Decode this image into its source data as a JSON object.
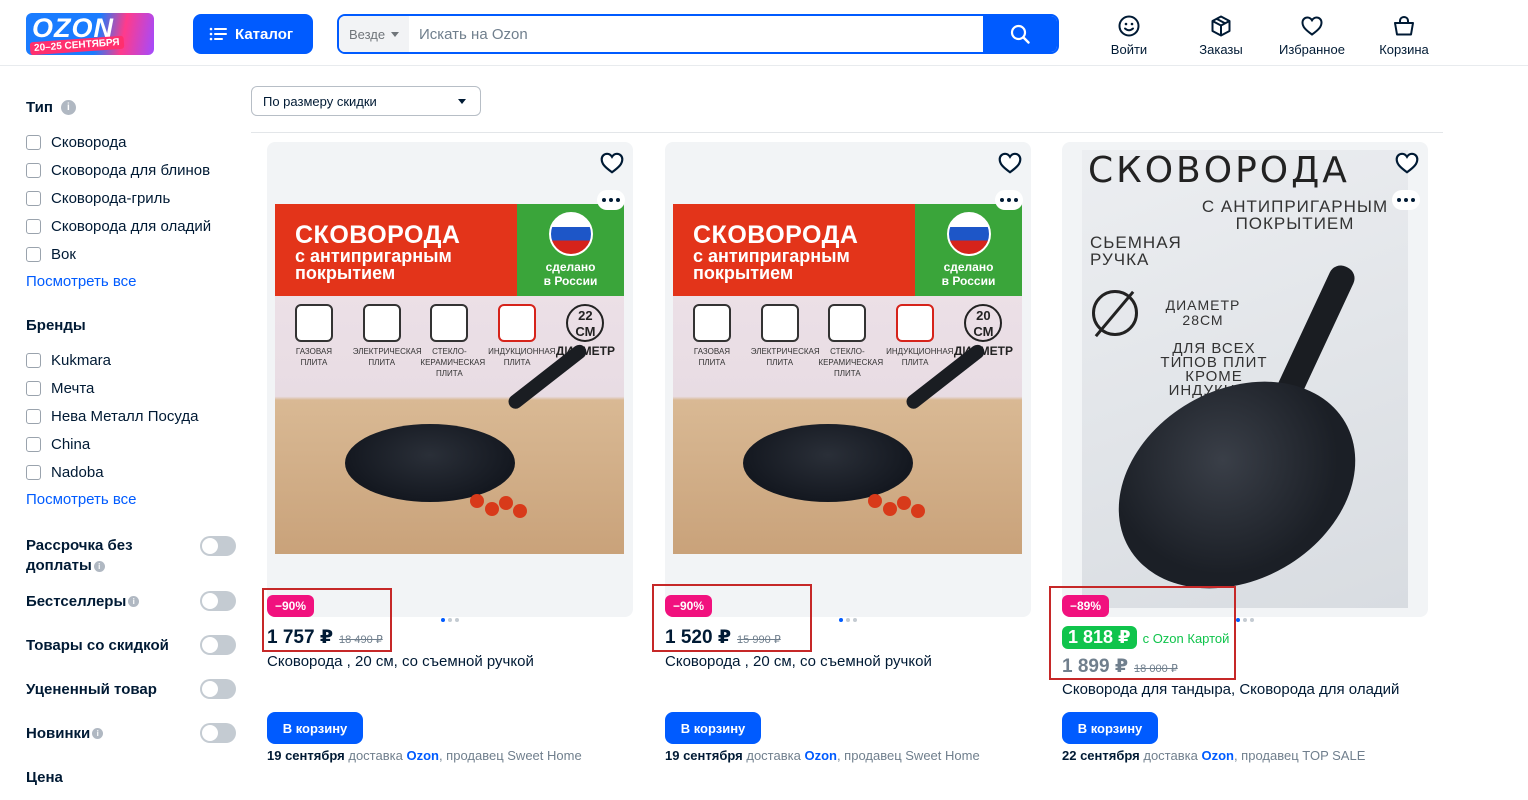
{
  "header": {
    "logo_text": "OZON",
    "logo_dates": "20–25 СЕНТЯБРЯ",
    "catalog_label": "Каталог",
    "search_scope": "Везде",
    "search_placeholder": "Искать на Ozon",
    "icons": [
      {
        "name": "user-smile-icon",
        "label": "Войти"
      },
      {
        "name": "box-icon",
        "label": "Заказы"
      },
      {
        "name": "heart-icon",
        "label": "Избранное"
      },
      {
        "name": "bag-icon",
        "label": "Корзина"
      }
    ]
  },
  "sidebar": {
    "type_title": "Тип",
    "type_items": [
      "Сковорода",
      "Сковорода для блинов",
      "Сковорода-гриль",
      "Сковорода для оладий",
      "Вок"
    ],
    "see_all": "Посмотреть все",
    "brands_title": "Бренды",
    "brand_items": [
      "Kukmara",
      "Мечта",
      "Нева Металл Посуда",
      "China",
      "Nadoba"
    ],
    "toggles": [
      {
        "label": "Рассрочка без доплаты",
        "info": true,
        "on": false
      },
      {
        "label": "Бестселлеры",
        "info": true,
        "on": false
      },
      {
        "label": "Товары со скидкой",
        "info": false,
        "on": false
      },
      {
        "label": "Уцененный товар",
        "info": false,
        "on": false
      },
      {
        "label": "Новинки",
        "info": true,
        "on": false
      }
    ],
    "price_title": "Цена"
  },
  "sort": {
    "selected": "По размеру скидки"
  },
  "products": [
    {
      "discount": "−90%",
      "price": "1 757 ₽",
      "old_price": "18 490 ₽",
      "name": "Сковорода , 20 см, со съемной ручкой",
      "buy_label": "В корзину",
      "delivery_date": "19 сентября",
      "delivery_text": "доставка",
      "delivery_service": "Ozon",
      "seller": ", продавец Sweet Home",
      "image": {
        "title": "СКОВОРОДА",
        "sub1": "с антипригарным",
        "sub2": "покрытием",
        "made": "сделано",
        "made2": "в России",
        "stoves": [
          "ГАЗОВАЯ ПЛИТА",
          "ЭЛЕКТРИЧЕСКАЯ ПЛИТА",
          "СТЕКЛО-КЕРАМИЧЕСКАЯ ПЛИТА",
          "ИНДУКЦИОННАЯ ПЛИТА"
        ],
        "diam_num": "22",
        "diam_unit": "СМ",
        "diam_label": "ДИАМЕТР"
      }
    },
    {
      "discount": "−90%",
      "price": "1 520 ₽",
      "old_price": "15 990 ₽",
      "name": "Сковорода , 20 см, со съемной ручкой",
      "buy_label": "В корзину",
      "delivery_date": "19 сентября",
      "delivery_text": "доставка",
      "delivery_service": "Ozon",
      "seller": ", продавец Sweet Home",
      "image": {
        "title": "СКОВОРОДА",
        "sub1": "с антипригарным",
        "sub2": "покрытием",
        "made": "сделано",
        "made2": "в России",
        "stoves": [
          "ГАЗОВАЯ ПЛИТА",
          "ЭЛЕКТРИЧЕСКАЯ ПЛИТА",
          "СТЕКЛО-КЕРАМИЧЕСКАЯ ПЛИТА",
          "ИНДУКЦИОННАЯ ПЛИТА"
        ],
        "diam_num": "20",
        "diam_unit": "СМ",
        "diam_label": "ДИАМЕТР"
      }
    },
    {
      "discount": "−89%",
      "ozon_card_price": "1 818 ₽",
      "ozon_card_label": "с Ozon Картой",
      "price": "1 899 ₽",
      "old_price": "18 000 ₽",
      "name": "Сковорода для тандыра, Сковорода для оладий",
      "buy_label": "В корзину",
      "delivery_date": "22 сентября",
      "delivery_text": "доставка",
      "delivery_service": "Ozon",
      "seller": ", продавец TOP SALE",
      "image": {
        "title": "СКОВОРОДА",
        "sub": "С АНТИПРИГАРНЫМ ПОКРЫТИЕМ",
        "handle": "СЬЕМНАЯ РУЧКА",
        "diam": "ДИАМЕТР 28СМ",
        "stoves": "ДЛЯ ВСЕХ ТИПОВ ПЛИТ КРОМЕ ИНДУКЦИИ"
      }
    }
  ],
  "colors": {
    "brand_blue": "#005bff",
    "discount_pink": "#f1117e",
    "ozon_green": "#10c44c",
    "highlight_red": "#c62828"
  }
}
